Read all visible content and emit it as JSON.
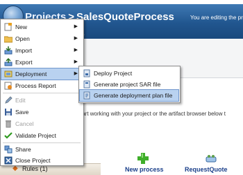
{
  "header": {
    "projects_label": "Projects",
    "separator": ">",
    "process_name": "SalesQuoteProcess",
    "editing_text": "You are editing the proje",
    "plus_label": "+"
  },
  "main_text": "start working with your project or the artifact browser below t",
  "main_menu": [
    {
      "label": "New",
      "icon": "new-file-icon",
      "has_submenu": true,
      "enabled": true
    },
    {
      "label": "Open",
      "icon": "folder-icon",
      "has_submenu": true,
      "enabled": true
    },
    {
      "label": "Import",
      "icon": "import-icon",
      "has_submenu": true,
      "enabled": true
    },
    {
      "label": "Export",
      "icon": "export-icon",
      "has_submenu": true,
      "enabled": true
    },
    {
      "label": "Deployment",
      "icon": "deployment-icon",
      "has_submenu": true,
      "enabled": true,
      "highlighted": true
    },
    {
      "label": "Process Report",
      "icon": "report-icon",
      "has_submenu": false,
      "enabled": true
    },
    {
      "label": "Edit",
      "icon": "edit-icon",
      "has_submenu": false,
      "enabled": false
    },
    {
      "label": "Save",
      "icon": "save-icon",
      "has_submenu": false,
      "enabled": true
    },
    {
      "label": "Cancel",
      "icon": "trash-icon",
      "has_submenu": false,
      "enabled": false
    },
    {
      "label": "Validate Project",
      "icon": "checkmark-icon",
      "has_submenu": false,
      "enabled": true
    },
    {
      "label": "Share",
      "icon": "share-icon",
      "has_submenu": false,
      "enabled": true
    },
    {
      "label": "Close Project",
      "icon": "close-project-icon",
      "has_submenu": false,
      "enabled": true
    }
  ],
  "deployment_submenu": [
    {
      "label": "Deploy Project",
      "icon": "deploy-icon"
    },
    {
      "label": "Generate project SAR file",
      "icon": "sar-file-icon"
    },
    {
      "label": "Generate deployment plan file",
      "icon": "plan-file-icon",
      "highlighted": true
    }
  ],
  "bottom": {
    "rules_label": "Rules (1)",
    "new_process_label": "New process",
    "request_quote_label": "RequestQuote"
  },
  "colors": {
    "titlebar": "#21568f",
    "menu_highlight": "#b9d2f0",
    "link_blue": "#1a3f8a"
  }
}
